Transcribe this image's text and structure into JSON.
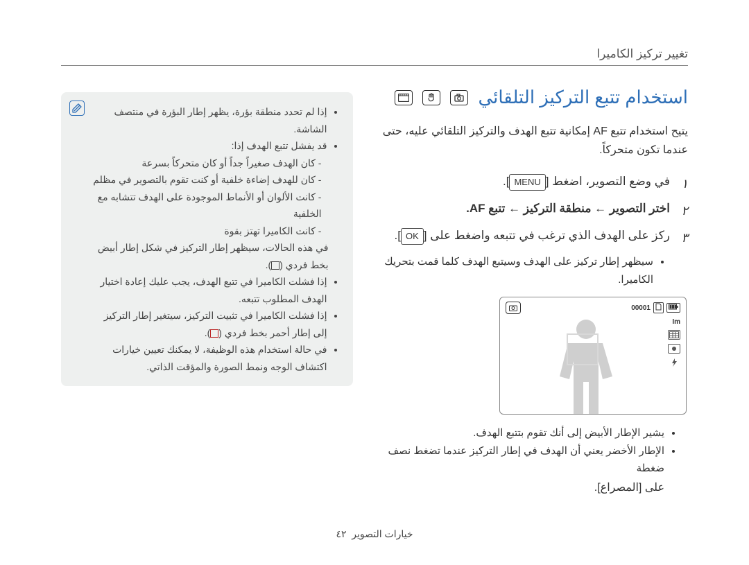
{
  "header": {
    "title": "تغيير تركيز الكاميرا"
  },
  "main": {
    "title": "استخدام تتبع التركيز التلقائي",
    "intro": "يتيح استخدام تتبع AF إمكانية تتبع الهدف والتركيز التلقائي عليه، حتى عندما تكون متحركاً.",
    "steps": [
      {
        "prefix": "في وضع التصوير، اضغط ",
        "btn": "MENU",
        "suffix": "."
      },
      {
        "text": "اختر التصوير ← منطقة التركيز ← تتبع AF."
      },
      {
        "prefix": "ركز على الهدف الذي ترغب في تتبعه واضغط على ",
        "btn": "OK",
        "suffix": "."
      }
    ],
    "sub_bullets": [
      "سيظهر إطار تركيز على الهدف وسيتبع الهدف كلما قمت بتحريك الكاميرا."
    ],
    "after_bullets": [
      "يشير الإطار الأبيض إلى أنك تقوم بتتبع الهدف.",
      "الإطار الأخضر يعني أن الهدف في إطار التركيز عندما تضغط نصف ضغطة"
    ],
    "shutter_line": "على [المصراع].",
    "screen": {
      "counter": "00001",
      "side_labels": [
        "Im"
      ]
    }
  },
  "note": {
    "bullets_top": [
      "إذا لم تحدد منطقة بؤرة، يظهر إطار البؤرة في منتصف الشاشة.",
      "قد يفشل تتبع الهدف إذا:"
    ],
    "dash_list": [
      "كان الهدف صغيراً جداً أو كان متحركاً بسرعة",
      "كان للهدف إضاءة خلفية أو كنت تقوم بالتصوير في مظلم",
      "كانت الألوان أو الأنماط الموجودة على الهدف تتشابه مع الخلفية",
      "كانت الكاميرا تهتز بقوة"
    ],
    "after_dash": "في هذه الحالات، سيظهر إطار التركيز في شكل إطار أبيض بخط فردي (",
    "after_dash_suffix": ").",
    "bullets_bottom": [
      "إذا فشلت الكاميرا في تتبع الهدف، يجب عليك إعادة اختيار الهدف المطلوب تتبعه.",
      "إذا فشلت الكاميرا في تثبيت التركيز، سيتغير إطار التركيز إلى إطار أحمر بخط فردي (",
      "في حالة استخدام هذه الوظيفة، لا يمكنك تعيين خيارات اكتشاف الوجه ونمط الصورة والمؤقت الذاتي."
    ],
    "bullet_bottom_suffix": ")."
  },
  "footer": {
    "text": "خيارات التصوير",
    "page": "٤٢"
  }
}
